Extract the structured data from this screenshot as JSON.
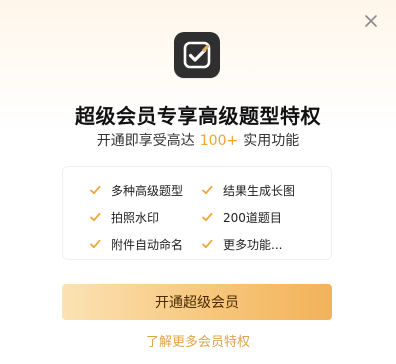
{
  "modal": {
    "title": "超级会员专享高级题型特权",
    "subtitle_prefix": "开通即享受高达",
    "subtitle_highlight": "100+",
    "subtitle_suffix": "实用功能",
    "features": [
      "多种高级题型",
      "结果生成长图",
      "拍照水印",
      "200道题目",
      "附件自动命名",
      "更多功能..."
    ],
    "cta_label": "开通超级会员",
    "link_label": "了解更多会员特权"
  },
  "icons": {
    "close": "close-icon",
    "app": "checkmark-app-icon",
    "feature_check": "check-icon"
  },
  "colors": {
    "accent": "#f0a531",
    "link": "#e0a44a",
    "cta_gradient_start": "#fbe2b4",
    "cta_gradient_end": "#f2b25a"
  }
}
